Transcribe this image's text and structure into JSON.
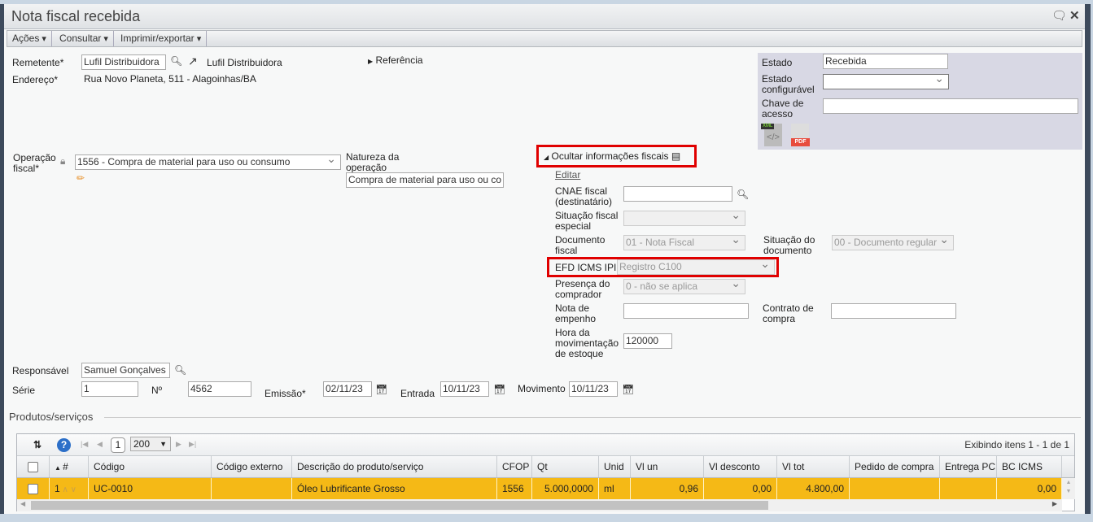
{
  "window": {
    "title": "Nota fiscal recebida"
  },
  "toolbar": {
    "acoes": "Ações",
    "consultar": "Consultar",
    "imprimir": "Imprimir/exportar"
  },
  "form": {
    "remetente_label": "Remetente*",
    "remetente_value": "Lufil Distribuidora",
    "remetente_link": "Lufil Distribuidora",
    "endereco_label": "Endereço*",
    "endereco_value": "Rua Novo Planeta, 511 - Alagoinhas/BA",
    "referencia": "Referência",
    "operacao_label": "Operação fiscal*",
    "operacao_value": "1556 - Compra de material para uso ou consumo",
    "natureza_label": "Natureza da operação",
    "natureza_value": "Compra de material para uso ou co",
    "responsavel_label": "Responsável",
    "responsavel_value": "Samuel Gonçalves",
    "serie_label": "Série",
    "serie_value": "1",
    "numero_label": "Nº",
    "numero_value": "4562",
    "emissao_label": "Emissão*",
    "emissao_value": "02/11/23",
    "entrada_label": "Entrada",
    "entrada_value": "10/11/23",
    "movimento_label": "Movimento",
    "movimento_value": "10/11/23"
  },
  "state": {
    "estado_label": "Estado",
    "estado_value": "Recebida",
    "estado_conf_label": "Estado configurável",
    "estado_conf_value": "",
    "chave_label": "Chave de acesso",
    "chave_value": "",
    "xml_badge": "XML",
    "pdf_badge": "PDF"
  },
  "fiscal": {
    "toggle": "Ocultar informações fiscais",
    "editar": "Editar",
    "cnae_label": "CNAE fiscal (destinatário)",
    "cnae_value": "",
    "situacao_esp_label": "Situação fiscal especial",
    "situacao_esp_value": "",
    "documento_label": "Documento fiscal",
    "documento_value": "01 - Nota Fiscal",
    "situacao_doc_label": "Situação do documento",
    "situacao_doc_value": "00 - Documento regular",
    "efd_label": "EFD ICMS IPI",
    "efd_value": "Registro C100",
    "presenca_label": "Presença do comprador",
    "presenca_value": "0 - não se aplica",
    "empenho_label": "Nota de empenho",
    "empenho_value": "",
    "contrato_label": "Contrato de compra",
    "contrato_value": "",
    "hora_label": "Hora da movimentação de estoque",
    "hora_value": "120000"
  },
  "products": {
    "section_title": "Produtos/serviços",
    "page": "1",
    "page_size": "200",
    "summary": "Exibindo itens 1 - 1 de 1",
    "columns": [
      "#",
      "Código",
      "Código externo",
      "Descrição do produto/serviço",
      "CFOP",
      "Qt",
      "Unid",
      "Vl un",
      "Vl desconto",
      "Vl tot",
      "Pedido de compra",
      "Entrega PC",
      "BC ICMS"
    ],
    "rows": [
      [
        "1",
        "UC-0010",
        "",
        "Óleo Lubrificante Grosso",
        "1556",
        "5.000,0000",
        "ml",
        "0,96",
        "0,00",
        "4.800,00",
        "",
        "",
        "0,00"
      ]
    ]
  },
  "colors": {
    "highlight": "#f5b916",
    "annotation": "#e00000"
  }
}
